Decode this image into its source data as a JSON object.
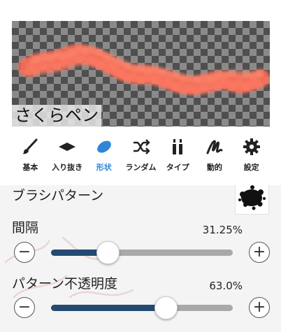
{
  "brush_preview": {
    "name": "さくらペン",
    "stroke_color": "#ff6e55"
  },
  "tabs": [
    {
      "id": "basic",
      "label": "基本",
      "icon": "brush-icon",
      "active": false
    },
    {
      "id": "entry_exit",
      "label": "入り抜き",
      "icon": "diamond-icon",
      "active": false
    },
    {
      "id": "shape",
      "label": "形状",
      "icon": "ellipse-icon",
      "active": true
    },
    {
      "id": "random",
      "label": "ランダム",
      "icon": "shuffle-icon",
      "active": false
    },
    {
      "id": "type",
      "label": "タイプ",
      "icon": "paint-tubes-icon",
      "active": false
    },
    {
      "id": "dynamics",
      "label": "動的",
      "icon": "scribble-icon",
      "active": false
    },
    {
      "id": "settings",
      "label": "設定",
      "icon": "gear-icon",
      "active": false
    }
  ],
  "brush_pattern": {
    "label": "ブラシパターン",
    "thumbnail": "splatter-pattern"
  },
  "spacing": {
    "label": "間隔",
    "value": "31.25%",
    "fraction": 0.3125,
    "minus": "−",
    "plus": "+"
  },
  "pattern_opacity": {
    "label": "パターン不透明度",
    "value": "63.0%",
    "fraction": 0.63,
    "minus": "−",
    "plus": "+"
  },
  "colors": {
    "accent": "#2f86d6",
    "slider_fill": "#244a72",
    "slider_track": "#a9a9a9"
  }
}
